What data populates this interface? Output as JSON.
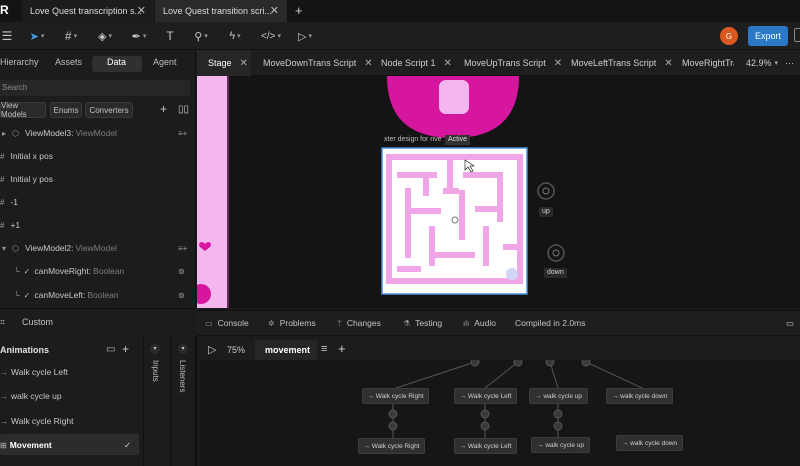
{
  "window_tabs": [
    {
      "label": "Love Quest transcription s..."
    },
    {
      "label": "Love Quest transition scri..."
    }
  ],
  "toolbar": {
    "avatar_initial": "G",
    "export_label": "Export"
  },
  "left_panel": {
    "tabs": [
      "Hierarchy",
      "Assets",
      "Data",
      "Agent"
    ],
    "active_tab": "Data",
    "search_placeholder": "Search",
    "chips": [
      "View Models",
      "Enums",
      "Converters"
    ],
    "rows": [
      {
        "name": "ViewModel3:",
        "type": "ViewModel"
      },
      {
        "name": "Initial x pos",
        "type": ""
      },
      {
        "name": "Initial y pos",
        "type": ""
      },
      {
        "name": "-1",
        "type": ""
      },
      {
        "name": "+1",
        "type": ""
      },
      {
        "name": "ViewModel2:",
        "type": "ViewModel"
      },
      {
        "name": "canMoveRight:",
        "type": "Boolean"
      },
      {
        "name": "canMoveLeft:",
        "type": "Boolean"
      }
    ],
    "custom_label": "Custom"
  },
  "stage_tabs": [
    "Stage",
    "MoveDownTrans Script",
    "Node Script 1",
    "MoveUpTrans Script",
    "MoveLeftTrans Script",
    "MoveRightTra"
  ],
  "zoom": "42.9%",
  "canvas": {
    "artboard_label": "xter design for rive",
    "artboard_badge": "Active",
    "up_label": "up",
    "down_label": "down"
  },
  "bottom_tabs": [
    "Console",
    "Problems",
    "Changes",
    "Testing",
    "Audio"
  ],
  "compile_status": "Compiled in 2.0ms",
  "animations": {
    "title": "Animations",
    "items": [
      "Walk cycle Left",
      "walk cycle up",
      "Walk cycle Right",
      "Movement"
    ],
    "active": "Movement",
    "inputs_label": "Inputs",
    "listeners_label": "Listeners"
  },
  "graph": {
    "speed": "75%",
    "tab": "movement",
    "top_nodes": [
      "Walk cycle Right",
      "Walk cycle Left",
      "walk cycle up",
      "walk cycle down"
    ],
    "bottom_nodes": [
      "Walk cycle Right",
      "Walk cycle Left",
      "walk cycle up",
      "walk cycle down"
    ]
  },
  "colors": {
    "accent": "#2979c7",
    "pink": "#f0a6e6",
    "magenta": "#d6169e",
    "avatar": "#d9581f"
  }
}
